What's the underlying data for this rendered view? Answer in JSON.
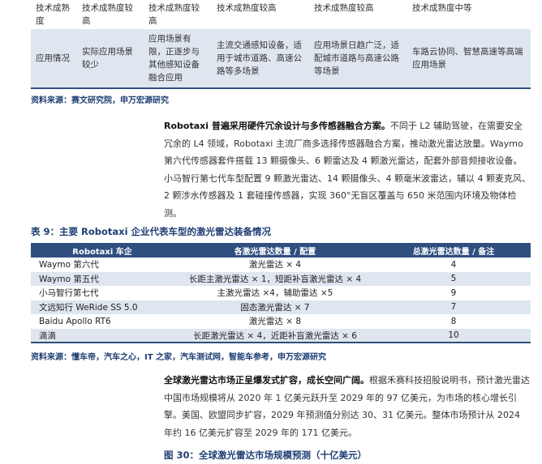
{
  "top_table": {
    "header": [
      "技术成熟度",
      "技术成熟度较高",
      "技术成熟度较高",
      "技术成熟度较高",
      "技术成熟度较高",
      "技术成熟度中等"
    ],
    "row": [
      "应用情况",
      "实际应用场景较少",
      "应用场景有限，正逐步与其他感知设备融合应用",
      "主流交通感知设备，适用于城市道路、高速公路等多场景",
      "应用场景日趋广泛，适配城市道路与高速公路等场景",
      "车路云协同、智慧高速等高端应用场景"
    ]
  },
  "source1": "资料来源：赛文研究院，申万宏源研究",
  "paragraph1": {
    "lead": "Robotaxi 普遍采用硬件冗余设计与多传感器融合方案。",
    "body": "不同于 L2 辅助驾驶，在需要安全冗余的 L4 领域，Robotaxi 主流厂商多选择传感器融合方案，推动激光雷达放量。Waymo 第六代传感器套件搭载 13 颗摄像头、6 颗雷达及 4 颗激光雷达，配套外部音频接收设备。小马智行第七代车型配置 9 颗激光雷达、14 颗摄像头、4 颗毫米波雷达，辅以 4 颗麦克风、2 颗涉水传感器及 1 套碰撞传感器，实现 360°无盲区覆盖与 650 米范围内环境及物体检测。"
  },
  "table9": {
    "caption": "表 9：主要 Robotaxi 企业代表车型的激光雷达装备情况",
    "headers": [
      "Robotaxi 车企",
      "各激光雷达数量 / 配置",
      "总激光雷达数量 / 备注"
    ],
    "rows": [
      [
        "Waymo 第六代",
        "激光雷达 × 4",
        "4"
      ],
      [
        "Waymo 第五代",
        "长距主激光雷达 × 1，短距补盲激光雷达 × 4",
        "5"
      ],
      [
        "小马智行第七代",
        "主激光雷达 ×4，辅助雷达 ×5",
        "9"
      ],
      [
        "文远知行 WeRide SS 5.0",
        "固态激光雷达 × 7",
        "7"
      ],
      [
        "Baidu Apollo RT6",
        "激光雷达 × 8",
        "8"
      ],
      [
        "滴滴",
        "长距激光雷达 × 4，近距补盲激光雷达 × 6",
        "10"
      ]
    ]
  },
  "source2": "资料来源：懂车帝，汽车之心，IT 之家，汽车测试网，智能车参考，申万宏源研究",
  "paragraph2": {
    "lead": "全球激光雷达市场正呈爆发式扩容，成长空间广阔。",
    "body": "根据禾赛科技招股说明书，预计激光雷达中国市场规模将从 2020 年 1 亿美元跃升至 2029 年的 97 亿美元，为市场的核心增长引擎。美国、欧盟同步扩容，2029 年预测值分别达 30、31 亿美元。整体市场预计从 2024 年约 16 亿美元扩容至 2029 年的 171 亿美元。"
  },
  "figure30_caption": "图 30：全球激光雷达市场规模预测（十亿美元）"
}
